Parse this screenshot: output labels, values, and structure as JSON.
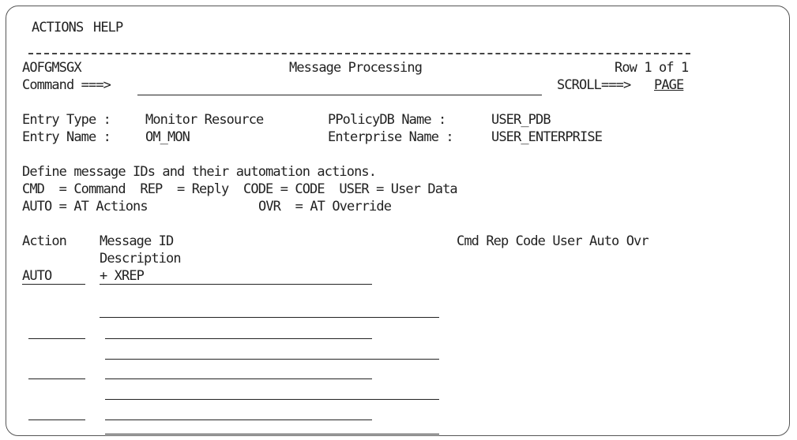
{
  "menu": {
    "actions": "ACTIONS",
    "help": "HELP"
  },
  "header": {
    "panel_id": "AOFGMSGX",
    "title": "Message Processing",
    "row_info": "Row 1 of 1"
  },
  "command": {
    "label": "Command ===>",
    "value": "",
    "scroll_label": "SCROLL===>",
    "scroll_value": "PAGE"
  },
  "entry": {
    "type_label": "Entry Type : ",
    "type_value": "Monitor Resource",
    "name_label": "Entry Name : ",
    "name_value": "OM_MON",
    "policydb_label": "PPolicyDB Name : ",
    "policydb_value": "USER_PDB",
    "enterprise_label": "Enterprise Name : ",
    "enterprise_value": "USER_ENTERPRISE"
  },
  "instructions": {
    "line1": "Define message IDs and their automation actions.",
    "line2": "CMD  = Command  REP  = Reply  CODE = CODE  USER = User Data",
    "line3_a": "AUTO = AT Actions",
    "line3_b": "OVR  = AT Override"
  },
  "table": {
    "col_action": "Action",
    "col_message_id": "Message ID",
    "col_description": "Description",
    "col_flags": "Cmd Rep Code User Auto Ovr",
    "rows": [
      {
        "action": "AUTO",
        "message_id": "+ XREP",
        "description": ""
      },
      {
        "action": "",
        "message_id": "",
        "description": ""
      },
      {
        "action": "",
        "message_id": "",
        "description": ""
      },
      {
        "action": "",
        "message_id": "",
        "description": ""
      }
    ]
  }
}
